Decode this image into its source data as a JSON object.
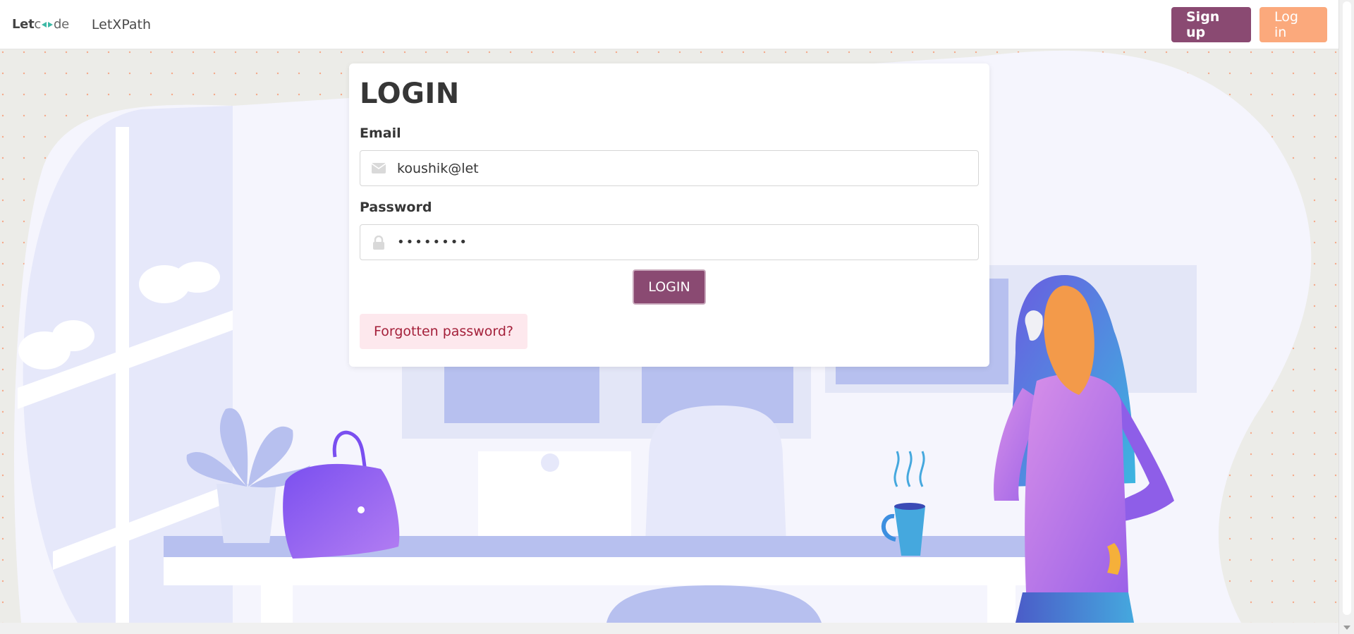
{
  "navbar": {
    "brand_prefix": "Let",
    "brand_suffix": "de",
    "link": "LetXPath",
    "signup_label": "Sign up",
    "login_label": "Log in"
  },
  "login_card": {
    "title": "LOGIN",
    "email_label": "Email",
    "email_value": "koushik@let",
    "password_label": "Password",
    "password_value": "••••••••",
    "submit_label": "LOGIN",
    "forgot_label": "Forgotten password?"
  },
  "colors": {
    "primary": "#8a4a72",
    "accent": "#fba97c",
    "danger_light": "#fde8ed",
    "danger_text": "#a4203a"
  },
  "icons": {
    "email": "envelope-icon",
    "password": "lock-icon"
  }
}
